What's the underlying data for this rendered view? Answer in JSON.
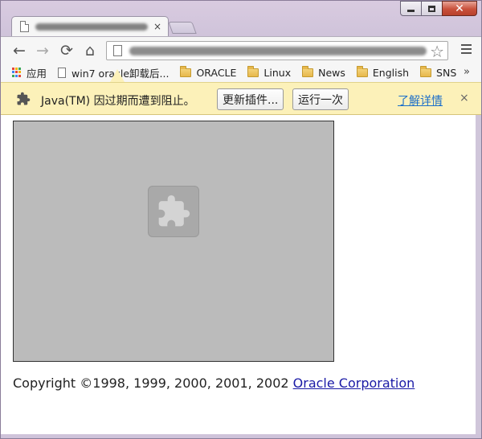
{
  "window": {
    "caption_buttons": [
      "minimize-icon",
      "maximize-icon",
      "close-icon"
    ],
    "close_glyph": "✕"
  },
  "tab": {
    "close_glyph": "×"
  },
  "toolbar": {
    "back_glyph": "←",
    "forward_glyph": "→",
    "reload_glyph": "⟳",
    "home_glyph": "⌂",
    "star_glyph": "☆"
  },
  "bookmarks": {
    "items": [
      {
        "label": "应用",
        "icon": "apps-icon"
      },
      {
        "label": "win7 oracle卸载后...",
        "icon": "page-icon"
      },
      {
        "label": "ORACLE",
        "icon": "folder-icon"
      },
      {
        "label": "Linux",
        "icon": "folder-icon"
      },
      {
        "label": "News",
        "icon": "folder-icon"
      },
      {
        "label": "English",
        "icon": "folder-icon"
      },
      {
        "label": "SNS",
        "icon": "folder-icon"
      }
    ],
    "overflow": "»"
  },
  "infobar": {
    "message": "Java(TM) 因过期而遭到阻止。",
    "update_button": "更新插件...",
    "run_once_button": "运行一次",
    "learn_more": "了解详情",
    "close": "×"
  },
  "page": {
    "copyright_text": "Copyright ©1998, 1999, 2000, 2001, 2002 ",
    "copyright_link": "Oracle Corporation"
  },
  "colors": {
    "infobar_bg": "#fcf1b9",
    "plugin_bg": "#bbbbbb",
    "link": "#1a1aa6"
  }
}
